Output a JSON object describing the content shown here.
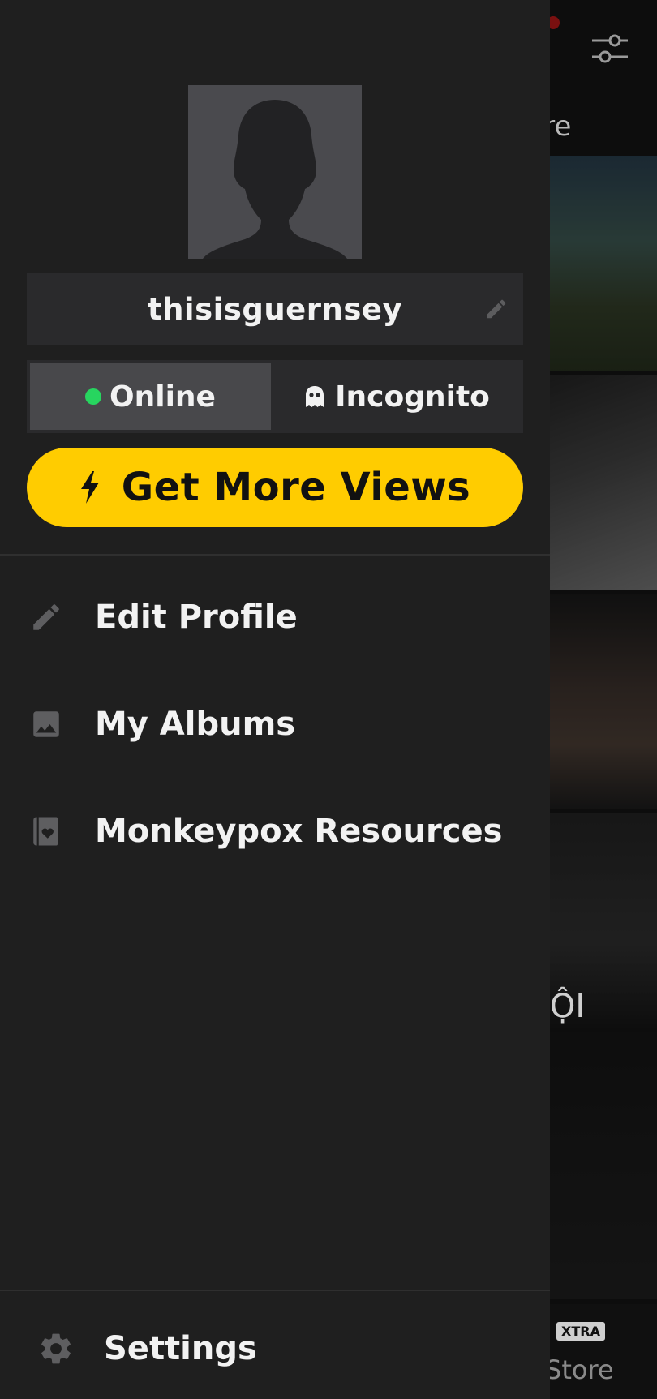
{
  "background_screen": {
    "tab_label_fragment": "lore",
    "tile_caption_fragment": "NỘI",
    "bottom_nav": {
      "badge": "XTRA",
      "label_fragment": "Store"
    },
    "icons": [
      "filter-sliders-icon"
    ],
    "notification_dot_color": "#7a1010"
  },
  "drawer": {
    "profile": {
      "avatar_icon": "default-avatar-silhouette",
      "username": "thisisguernsey",
      "username_edit_icon": "pencil-icon"
    },
    "status_toggle": {
      "selected": "online",
      "options": [
        {
          "id": "online",
          "label": "Online",
          "indicator_color": "#27d55f"
        },
        {
          "id": "incognito",
          "label": "Incognito",
          "icon": "ghost-icon"
        }
      ]
    },
    "boost_button": {
      "label": "Get More Views",
      "icon": "lightning-bolt-icon",
      "color": "#ffcc00"
    },
    "menu": [
      {
        "id": "edit-profile",
        "label": "Edit Profile",
        "icon": "pencil-icon"
      },
      {
        "id": "my-albums",
        "label": "My Albums",
        "icon": "image-icon"
      },
      {
        "id": "monkeypox-resources",
        "label": "Monkeypox Resources",
        "icon": "book-heart-icon"
      }
    ],
    "settings": {
      "label": "Settings",
      "icon": "gear-icon"
    }
  },
  "colors": {
    "drawer_bg": "#1f1f1f",
    "accent_yellow": "#ffcc00",
    "online_green": "#27d55f"
  }
}
